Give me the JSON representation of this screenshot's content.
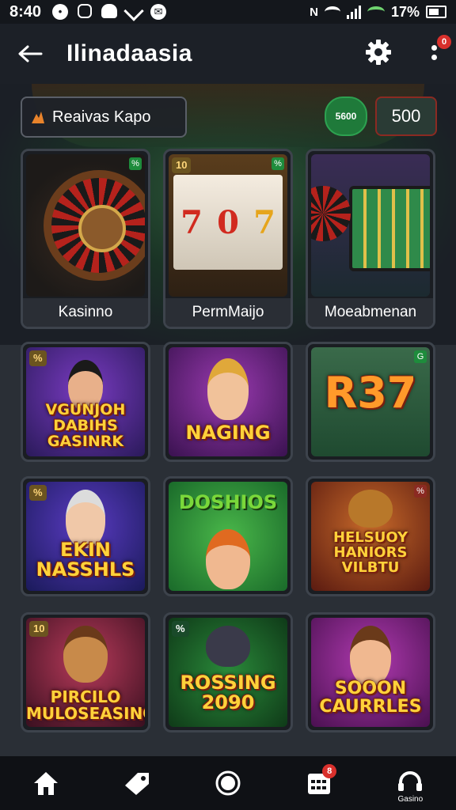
{
  "status_bar": {
    "time": "8:40",
    "battery": "17%",
    "left_icons": [
      "messenger-icon",
      "instagram-icon",
      "app-icon",
      "signal-icon",
      "mail-icon"
    ]
  },
  "header": {
    "title": "Ilinadaasia",
    "notification_count": "0"
  },
  "promo": {
    "label": "Reaivas Kapo",
    "chips_label": "5600",
    "coins_label": "500"
  },
  "games": [
    {
      "caption": "Kasinno",
      "badge": "",
      "mark": "%",
      "title": "",
      "art": "roulette"
    },
    {
      "caption": "PermMaijo",
      "badge": "10",
      "mark": "%",
      "title": "",
      "art": "slots"
    },
    {
      "caption": "Moeabmenan",
      "badge": "",
      "mark": "",
      "title": "",
      "art": "machines"
    },
    {
      "caption": "",
      "badge": "%",
      "mark": "",
      "title": "VGUNJOH DABIHS GASINRK",
      "art": "char1"
    },
    {
      "caption": "",
      "badge": "",
      "mark": "",
      "title": "NAGING",
      "art": "char2"
    },
    {
      "caption": "",
      "badge": "",
      "mark": "G",
      "title": "R37",
      "art": "r37"
    },
    {
      "caption": "",
      "badge": "%",
      "mark": "",
      "title": "EKIN NASSHLS",
      "art": "char3"
    },
    {
      "caption": "",
      "badge": "",
      "mark": "",
      "title": "DOSHIOS",
      "art": "char4"
    },
    {
      "caption": "",
      "badge": "",
      "mark": "%",
      "title": "HELSUOY HANIORS VILBTU",
      "art": "char5"
    },
    {
      "caption": "",
      "badge": "10",
      "mark": "",
      "title": "PIRCILO MULOSEASINON",
      "art": "char6"
    },
    {
      "caption": "",
      "badge": "%",
      "mark": "",
      "title": "ROSSING 2090",
      "art": "char7"
    },
    {
      "caption": "",
      "badge": "",
      "mark": "",
      "title": "SOOON CAURRLES",
      "art": "char8"
    }
  ],
  "bottom_nav": {
    "items": [
      {
        "name": "home",
        "icon": "home-icon"
      },
      {
        "name": "promotions",
        "icon": "tag-icon"
      },
      {
        "name": "record",
        "icon": "circle-icon"
      },
      {
        "name": "calendar",
        "icon": "calendar-icon",
        "badge": "8"
      },
      {
        "name": "support",
        "icon": "headset-icon",
        "label": "Gasino"
      }
    ]
  },
  "colors": {
    "background": "#2a2f36",
    "header": "#1c2027",
    "tile_border": "#3d434c",
    "badge_red": "#d9302c",
    "gold_text": "#ffd23a"
  }
}
